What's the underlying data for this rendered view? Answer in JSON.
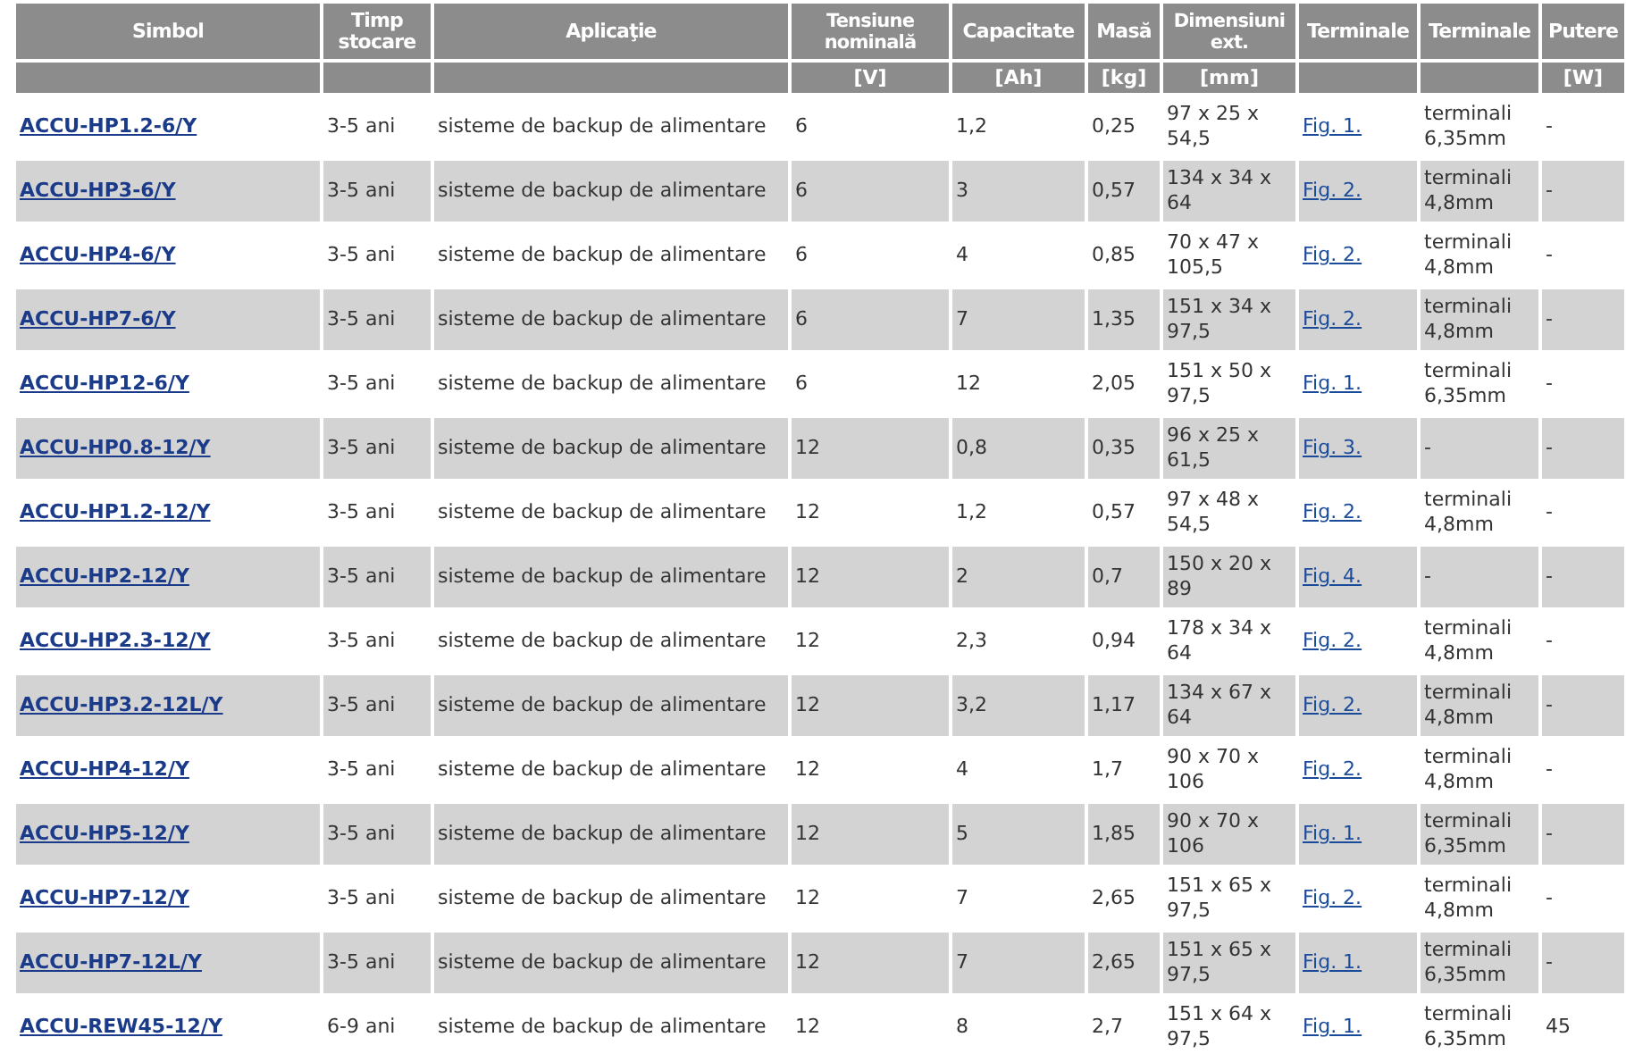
{
  "table": {
    "columns": [
      {
        "label": "Simbol"
      },
      {
        "label": "Timp stocare"
      },
      {
        "label": "Aplicaţie"
      },
      {
        "label": "Tensiune nominală",
        "unit": "[V]"
      },
      {
        "label": "Capacitate",
        "unit": "[Ah]"
      },
      {
        "label": "Masă",
        "unit": "[kg]"
      },
      {
        "label": "Dimensiuni ext.",
        "unit": "[mm]"
      },
      {
        "label": "Terminale"
      },
      {
        "label": "Terminale"
      },
      {
        "label": "Putere",
        "unit": "[W]"
      }
    ],
    "rows": [
      {
        "symbol": "ACCU-HP1.2-6/Y",
        "storage": "3-5 ani",
        "application": "sisteme de backup de alimentare",
        "voltage": "6",
        "capacity": "1,2",
        "mass": "0,25",
        "dimensions": "97 x 25 x 54,5",
        "figure": "Fig. 1.",
        "terminals": "terminali 6,35mm",
        "power": "-"
      },
      {
        "symbol": "ACCU-HP3-6/Y",
        "storage": "3-5 ani",
        "application": "sisteme de backup de alimentare",
        "voltage": "6",
        "capacity": "3",
        "mass": "0,57",
        "dimensions": "134 x 34 x 64",
        "figure": "Fig. 2.",
        "terminals": "terminali 4,8mm",
        "power": "-"
      },
      {
        "symbol": "ACCU-HP4-6/Y",
        "storage": "3-5 ani",
        "application": "sisteme de backup de alimentare",
        "voltage": "6",
        "capacity": "4",
        "mass": "0,85",
        "dimensions": "70 x 47 x 105,5",
        "figure": "Fig. 2.",
        "terminals": "terminali 4,8mm",
        "power": "-"
      },
      {
        "symbol": "ACCU-HP7-6/Y",
        "storage": "3-5 ani",
        "application": "sisteme de backup de alimentare",
        "voltage": "6",
        "capacity": "7",
        "mass": "1,35",
        "dimensions": "151 x 34 x 97,5",
        "figure": "Fig. 2.",
        "terminals": "terminali 4,8mm",
        "power": "-"
      },
      {
        "symbol": "ACCU-HP12-6/Y",
        "storage": "3-5 ani",
        "application": "sisteme de backup de alimentare",
        "voltage": "6",
        "capacity": "12",
        "mass": "2,05",
        "dimensions": "151 x 50 x 97,5",
        "figure": "Fig. 1.",
        "terminals": "terminali 6,35mm",
        "power": "-"
      },
      {
        "symbol": "ACCU-HP0.8-12/Y",
        "storage": "3-5 ani",
        "application": "sisteme de backup de alimentare",
        "voltage": "12",
        "capacity": "0,8",
        "mass": "0,35",
        "dimensions": "96 x 25 x 61,5",
        "figure": "Fig. 3.",
        "terminals": "-",
        "power": "-"
      },
      {
        "symbol": "ACCU-HP1.2-12/Y",
        "storage": "3-5 ani",
        "application": "sisteme de backup de alimentare",
        "voltage": "12",
        "capacity": "1,2",
        "mass": "0,57",
        "dimensions": "97 x 48 x 54,5",
        "figure": "Fig. 2.",
        "terminals": "terminali 4,8mm",
        "power": "-"
      },
      {
        "symbol": "ACCU-HP2-12/Y",
        "storage": "3-5 ani",
        "application": "sisteme de backup de alimentare",
        "voltage": "12",
        "capacity": "2",
        "mass": "0,7",
        "dimensions": "150 x 20 x 89",
        "figure": "Fig. 4.",
        "terminals": "-",
        "power": "-"
      },
      {
        "symbol": "ACCU-HP2.3-12/Y",
        "storage": "3-5 ani",
        "application": "sisteme de backup de alimentare",
        "voltage": "12",
        "capacity": "2,3",
        "mass": "0,94",
        "dimensions": "178 x 34 x 64",
        "figure": "Fig. 2.",
        "terminals": "terminali 4,8mm",
        "power": "-"
      },
      {
        "symbol": "ACCU-HP3.2-12L/Y",
        "storage": "3-5 ani",
        "application": "sisteme de backup de alimentare",
        "voltage": "12",
        "capacity": "3,2",
        "mass": "1,17",
        "dimensions": "134 x 67 x 64",
        "figure": "Fig. 2.",
        "terminals": "terminali 4,8mm",
        "power": "-"
      },
      {
        "symbol": "ACCU-HP4-12/Y",
        "storage": "3-5 ani",
        "application": "sisteme de backup de alimentare",
        "voltage": "12",
        "capacity": "4",
        "mass": "1,7",
        "dimensions": "90 x 70 x 106",
        "figure": "Fig. 2.",
        "terminals": "terminali 4,8mm",
        "power": "-"
      },
      {
        "symbol": "ACCU-HP5-12/Y",
        "storage": "3-5 ani",
        "application": "sisteme de backup de alimentare",
        "voltage": "12",
        "capacity": "5",
        "mass": "1,85",
        "dimensions": "90 x 70 x 106",
        "figure": "Fig. 1.",
        "terminals": "terminali 6,35mm",
        "power": "-"
      },
      {
        "symbol": "ACCU-HP7-12/Y",
        "storage": "3-5 ani",
        "application": "sisteme de backup de alimentare",
        "voltage": "12",
        "capacity": "7",
        "mass": "2,65",
        "dimensions": "151 x 65 x 97,5",
        "figure": "Fig. 2.",
        "terminals": "terminali 4,8mm",
        "power": "-"
      },
      {
        "symbol": "ACCU-HP7-12L/Y",
        "storage": "3-5 ani",
        "application": "sisteme de backup de alimentare",
        "voltage": "12",
        "capacity": "7",
        "mass": "2,65",
        "dimensions": "151 x 65 x 97,5",
        "figure": "Fig. 1.",
        "terminals": "terminali 6,35mm",
        "power": "-"
      },
      {
        "symbol": "ACCU-REW45-12/Y",
        "storage": "6-9 ani",
        "application": "sisteme de backup de alimentare",
        "voltage": "12",
        "capacity": "8",
        "mass": "2,7",
        "dimensions": "151 x 64 x 97,5",
        "figure": "Fig. 1.",
        "terminals": "terminali 6,35mm",
        "power": "45"
      }
    ]
  }
}
